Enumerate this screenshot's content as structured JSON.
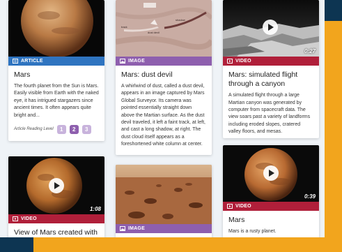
{
  "cards": [
    {
      "type": "ARTICLE",
      "title": "Mars",
      "description": "The fourth planet from the Sun is Mars. Easily visible from Earth with the naked eye, it has intrigued stargazers since ancient times. It often appears quite bright and...",
      "thumb_icon": "mars-planet-image"
    },
    {
      "type": "IMAGE",
      "title": "Mars: dust devil",
      "description": "A whirlwind of dust, called a dust devil, appears in an image captured by Mars Global Surveyor. Its camera was pointed essentially straight down above the Martian surface. As the dust devil traveled, it left a faint track, at left, and cast a long shadow, at right. The dust cloud itself appears as a foreshortened white column at center.",
      "thumb_icon": "dust-devil-image"
    },
    {
      "type": "VIDEO",
      "title": "Mars: simulated flight through a canyon",
      "description": "A simulated flight through a large Martian canyon was generated by computer from spacecraft data. The view soars past a variety of landforms including eroded slopes, cratered valley floors, and mesas.",
      "duration": "0:27",
      "thumb_icon": "canyon-video-thumbnail"
    },
    {
      "type": "VIDEO",
      "title": "View of Mars created with data",
      "duration": "1:08",
      "thumb_icon": "mars-video-thumbnail"
    },
    {
      "type": "IMAGE",
      "title": "",
      "thumb_icon": "mars-surface-image"
    },
    {
      "type": "VIDEO",
      "title": "Mars",
      "description": "Mars is a rusty planet.",
      "duration": "0:39",
      "thumb_icon": "mars-video-thumbnail"
    }
  ],
  "reading_level": {
    "label": "Article Reading Level",
    "levels": [
      "1",
      "2",
      "3"
    ],
    "selected": "2"
  },
  "colors": {
    "article": "#2f74c0",
    "image": "#8e5fae",
    "video": "#b01f3a",
    "frame_orange": "#f2a51d",
    "background_navy": "#0d3552"
  }
}
